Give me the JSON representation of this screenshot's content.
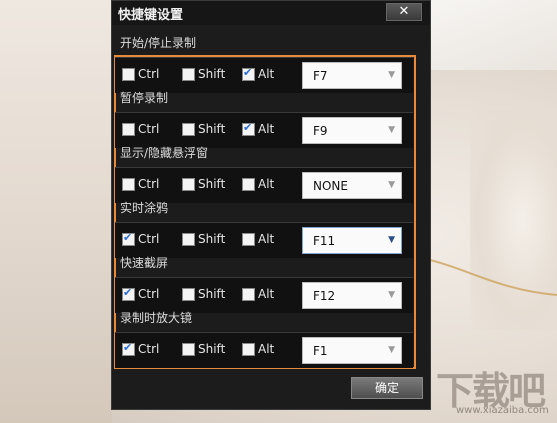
{
  "dialog": {
    "title": "快捷键设置",
    "close_label": "✕",
    "ok_label": "确定"
  },
  "sections": [
    {
      "label": "开始/停止录制",
      "ctrl": false,
      "shift": false,
      "alt": true,
      "key": "F7",
      "focused": false
    },
    {
      "label": "暂停录制",
      "ctrl": false,
      "shift": false,
      "alt": true,
      "key": "F9",
      "focused": false
    },
    {
      "label": "显示/隐藏悬浮窗",
      "ctrl": false,
      "shift": false,
      "alt": false,
      "key": "NONE",
      "focused": false
    },
    {
      "label": "实时涂鸦",
      "ctrl": true,
      "shift": false,
      "alt": false,
      "key": "F11",
      "focused": true
    },
    {
      "label": "快速截屏",
      "ctrl": true,
      "shift": false,
      "alt": false,
      "key": "F12",
      "focused": false
    },
    {
      "label": "录制时放大镜",
      "ctrl": true,
      "shift": false,
      "alt": false,
      "key": "F1",
      "focused": false
    }
  ],
  "modifiers": {
    "ctrl": "Ctrl",
    "shift": "Shift",
    "alt": "Alt"
  },
  "icons": {
    "dropdown": "chevron-down-icon",
    "check": "checkmark-icon",
    "close": "close-icon"
  },
  "watermark": {
    "logo": "下载吧",
    "url": "www.xiazaiba.com"
  }
}
